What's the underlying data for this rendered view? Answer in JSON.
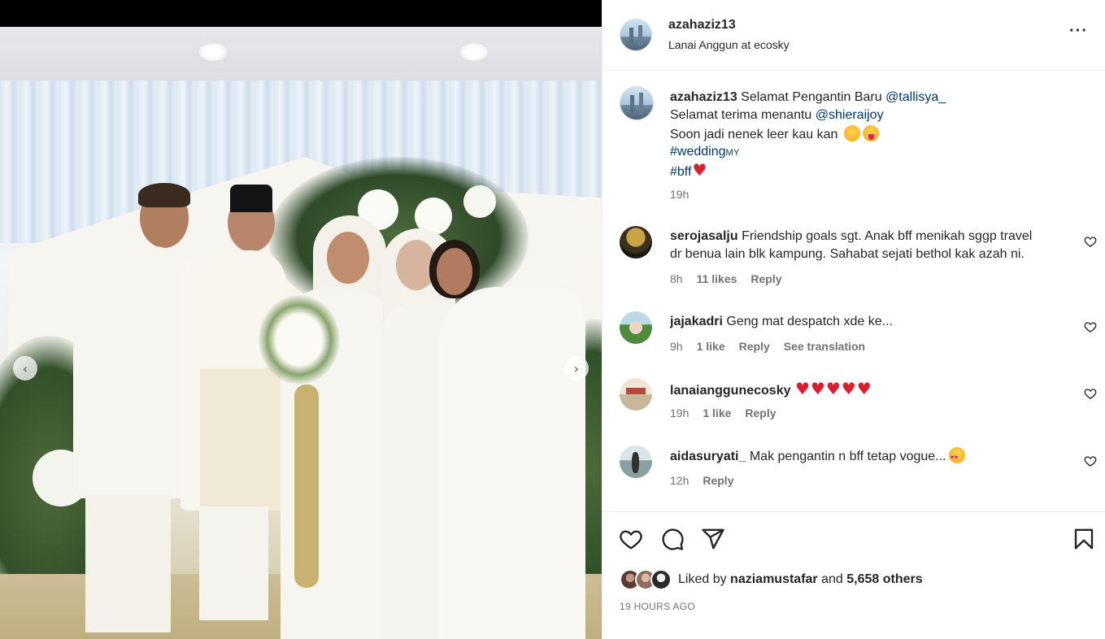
{
  "post": {
    "photo_alt": "",
    "image_nav": {
      "prev": "‹",
      "next": "›"
    }
  },
  "header": {
    "username": "azahaziz13",
    "location": "Lanai Anggun at ecosky",
    "more": "···"
  },
  "caption": {
    "username": "azahaziz13",
    "line1_text": "Selamat Pengantin Baru ",
    "line1_mention": "@tallisya_",
    "line2_text": "Selamat terima menantu ",
    "line2_mention": "@shieraijoy",
    "line3_text": "Soon jadi nenek leer kau kan",
    "hashtag1": "#wedding",
    "hashtag1_suffix": "MY",
    "hashtag2": "#bff",
    "heart": "♥",
    "time": "19h"
  },
  "comments": [
    {
      "username": "serojasalju",
      "text_line1": "Friendship goals sgt. Anak bff menikah sggp travel",
      "text_line2": "dr benua lain blk kampung. Sahabat sejati bethol kak azah ni.",
      "time": "8h",
      "likes": "11 likes",
      "reply": "Reply"
    },
    {
      "username": "jajakadri",
      "text_line1": "Geng mat despatch xde ke...",
      "time": "9h",
      "likes": "1 like",
      "reply": "Reply",
      "translate": "See translation"
    },
    {
      "username": "lanaianggunecosky",
      "hearts": [
        "♥",
        "♥",
        "♥",
        "♥",
        "♥"
      ],
      "time": "19h",
      "likes": "1 like",
      "reply": "Reply"
    },
    {
      "username": "aidasuryati_",
      "text_line1": "Mak pengantin n bff tetap vogue...",
      "time": "12h",
      "reply": "Reply"
    }
  ],
  "actions": {
    "liked_by_prefix": "Liked by ",
    "liked_by_user": "naziamustafar",
    "liked_by_mid": " and ",
    "liked_by_others": "5,658 others",
    "timestamp": "19 HOURS AGO"
  }
}
